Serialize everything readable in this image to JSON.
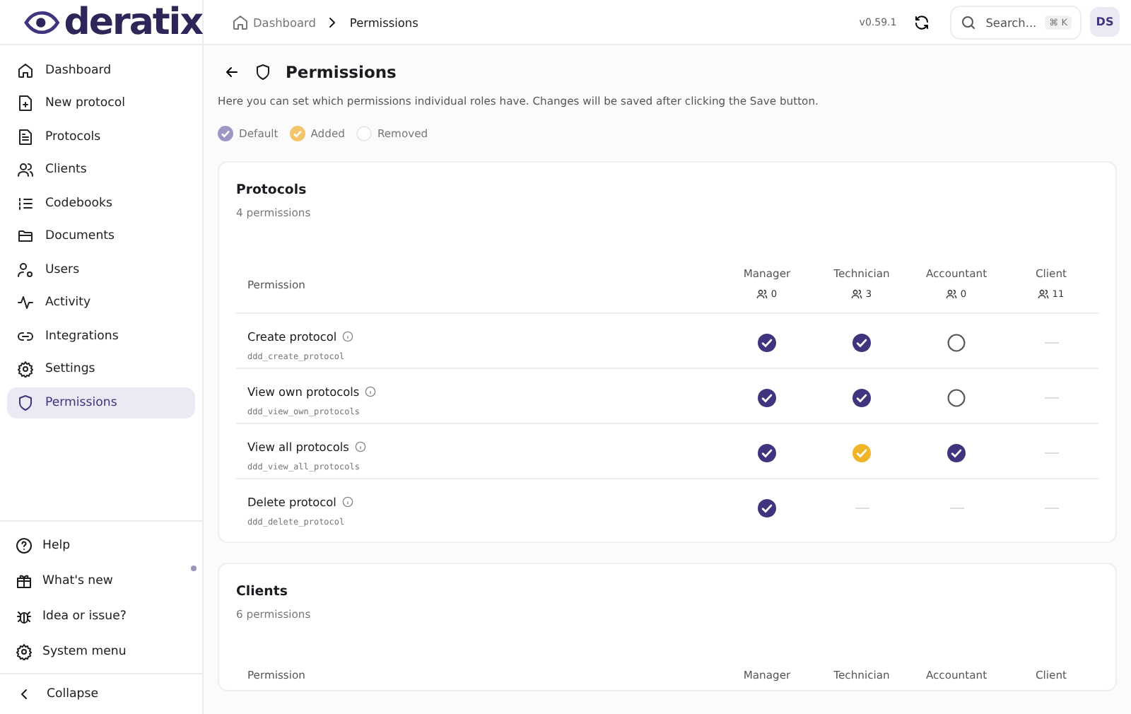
{
  "logo": {
    "text": "deratix"
  },
  "sidebar": {
    "items": [
      {
        "label": "Dashboard",
        "selected": false
      },
      {
        "label": "New protocol",
        "selected": false
      },
      {
        "label": "Protocols",
        "selected": false
      },
      {
        "label": "Clients",
        "selected": false
      },
      {
        "label": "Codebooks",
        "selected": false
      },
      {
        "label": "Documents",
        "selected": false
      },
      {
        "label": "Users",
        "selected": false
      },
      {
        "label": "Activity",
        "selected": false
      },
      {
        "label": "Integrations",
        "selected": false
      },
      {
        "label": "Settings",
        "selected": false
      },
      {
        "label": "Permissions",
        "selected": true
      }
    ],
    "bottom_items": [
      {
        "label": "Help",
        "unread": false
      },
      {
        "label": "What's new",
        "unread": true
      },
      {
        "label": "Idea or issue?",
        "unread": false
      },
      {
        "label": "System menu",
        "unread": false
      }
    ],
    "collapse": "Collapse"
  },
  "breadcrumb": [
    "Dashboard",
    "Permissions"
  ],
  "header": {
    "version": "v0.59.1",
    "search_placeholder": "Search...",
    "shortcut": "⌘ K",
    "avatar": "DS"
  },
  "page": {
    "title": "Permissions",
    "description": "Here you can set which permissions individual roles have. Changes will be saved after clicking the Save button.",
    "legend": [
      {
        "kind": "default",
        "label": "Default"
      },
      {
        "kind": "added",
        "label": "Added"
      },
      {
        "kind": "removed",
        "label": "Removed"
      }
    ]
  },
  "sections": [
    {
      "title": "Protocols",
      "count": "4 permissions",
      "permission_header": "Permission",
      "roles": [
        {
          "name": "Manager",
          "users": "0"
        },
        {
          "name": "Technician",
          "users": "3"
        },
        {
          "name": "Accountant",
          "users": "0"
        },
        {
          "name": "Client",
          "users": "11"
        }
      ],
      "rows": [
        {
          "name": "Create protocol",
          "code": "ddd_create_protocol",
          "cells": [
            {
              "kind": "default"
            },
            {
              "kind": "default"
            },
            {
              "kind": "empty"
            },
            {
              "kind": "none"
            }
          ]
        },
        {
          "name": "View own protocols",
          "code": "ddd_view_own_protocols",
          "cells": [
            {
              "kind": "default"
            },
            {
              "kind": "default"
            },
            {
              "kind": "empty"
            },
            {
              "kind": "none"
            }
          ]
        },
        {
          "name": "View all protocols",
          "code": "ddd_view_all_protocols",
          "cells": [
            {
              "kind": "default"
            },
            {
              "kind": "added"
            },
            {
              "kind": "default"
            },
            {
              "kind": "none"
            }
          ]
        },
        {
          "name": "Delete protocol",
          "code": "ddd_delete_protocol",
          "cells": [
            {
              "kind": "default"
            },
            {
              "kind": "none"
            },
            {
              "kind": "none"
            },
            {
              "kind": "none"
            }
          ]
        }
      ]
    },
    {
      "title": "Clients",
      "count": "6 permissions",
      "permission_header": "Permission",
      "roles": [
        {
          "name": "Manager"
        },
        {
          "name": "Technician"
        },
        {
          "name": "Accountant"
        },
        {
          "name": "Client"
        }
      ]
    }
  ]
}
